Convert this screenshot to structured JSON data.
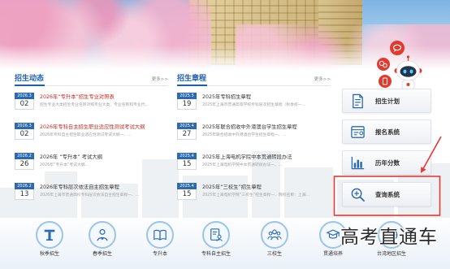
{
  "news": {
    "title": "招生动态",
    "more": "更多>>",
    "items": [
      {
        "date_top": "2026.3",
        "date_day": "02",
        "title": "2026年“专升本”招生专业对照表",
        "summary": "招生专业大类招生专业名称对照专业大类、专业名称和专业代...",
        "title_color": "#d0261c"
      },
      {
        "date_top": "2026.3",
        "date_day": "02",
        "title": "2026年专科自主招生职业适应性测试考试大纲",
        "summary": "2026年专科自主招生职业适应性测试考试大纲一、...",
        "title_color": "#d0261c"
      },
      {
        "date_top": "2026.2",
        "date_day": "26",
        "title": "2026年 “专升本” 考试大纲",
        "summary": "2026年“专升本”考试大纲...",
        "title_color": "#333333"
      },
      {
        "date_top": "2026.2",
        "date_day": "13",
        "title": "2026年专科层次依法自主招生章程",
        "summary": "2026年上海市普通高校专科层次依法自主招生章程一、...",
        "title_color": "#333333"
      }
    ]
  },
  "charter": {
    "title": "招生章程",
    "more": "更多>>",
    "items": [
      {
        "date_top": "2025.5",
        "date_day": "19",
        "title": "2025年专科招生章程",
        "summary": "2025年上海市普通高等学校专科层次招生章程（秋季统一...",
        "title_color": "#333333"
      },
      {
        "date_top": "2025.4",
        "date_day": "27",
        "title": "2025年联合招收中外港澳台学生招生章程",
        "summary": "2025年联合招收中外港澳台学生招生章程一、...",
        "title_color": "#333333"
      },
      {
        "date_top": "2025.4",
        "date_day": "15",
        "title": "2025年上海电机学院中本贯通转段办法",
        "summary": "2025年上海电机学院中本贯通转段办法一、...",
        "title_color": "#333333"
      },
      {
        "date_top": "2025.4",
        "date_day": "15",
        "title": "2025年“三校生”招生章程",
        "summary": "2025年上海电机学院“三校生”招生章程一、院校名称：上海...",
        "title_color": "#333333"
      }
    ]
  },
  "quick_links": [
    {
      "label": "招生计划",
      "icon": "document-list-icon"
    },
    {
      "label": "报名系统",
      "icon": "registration-card-icon"
    },
    {
      "label": "历年分数",
      "icon": "bar-chart-icon"
    },
    {
      "label": "查询系统",
      "icon": "search-plus-icon"
    }
  ],
  "categories": [
    {
      "label": "秋季招生",
      "icon": "pillar-icon"
    },
    {
      "label": "春季招生",
      "icon": "person-award-icon"
    },
    {
      "label": "专升本",
      "icon": "book-icon"
    },
    {
      "label": "专科自主招生",
      "icon": "document-user-icon"
    },
    {
      "label": "三校生",
      "icon": "people-group-icon"
    },
    {
      "label": "贯通培养",
      "icon": "students-icon"
    },
    {
      "label": "台湾地区招生",
      "icon": "globe-icon"
    }
  ],
  "watermark": "高考直通车",
  "colors": {
    "brand_blue": "#1d5fae",
    "date_blue": "#2c69b0",
    "hot_red": "#d0261c",
    "annotation_red": "#e53935",
    "mascot_red": "#e23b2e"
  }
}
